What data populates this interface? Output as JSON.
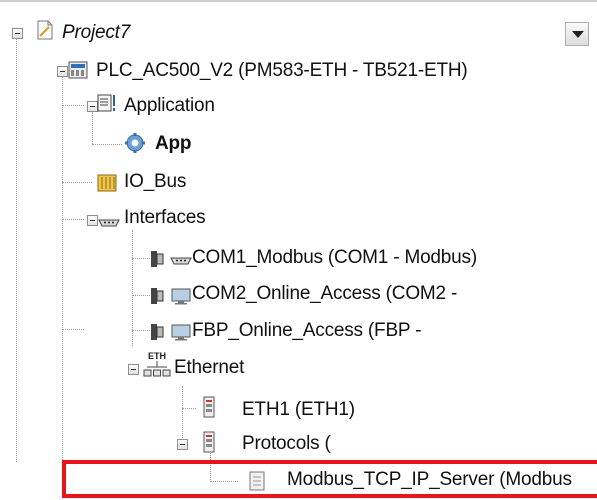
{
  "tree": {
    "items": [
      {
        "label": "Project7"
      },
      {
        "label": "PLC_AC500_V2 (PM583-ETH - TB521-ETH)"
      },
      {
        "label": "Application"
      },
      {
        "label": "App"
      },
      {
        "label": "IO_Bus"
      },
      {
        "label": "Interfaces"
      },
      {
        "label": "COM1_Modbus (COM1 - Modbus)"
      },
      {
        "label": "COM2_Online_Access (COM2 - "
      },
      {
        "label": "FBP_Online_Access (FBP - "
      },
      {
        "label": "Ethernet"
      },
      {
        "label": "ETH1 (ETH1)"
      },
      {
        "label": "Protocols ("
      },
      {
        "label": "Modbus_TCP_IP_Server (Modbus"
      }
    ],
    "icons": {
      "project": "document-icon",
      "plc": "plc-device-icon",
      "application": "application-icon",
      "app": "gear-icon",
      "io_bus": "io-bus-icon",
      "interfaces": "serial-port-icon",
      "eth_badge_text": "ETH"
    },
    "highlight_color": "#e8141a"
  }
}
